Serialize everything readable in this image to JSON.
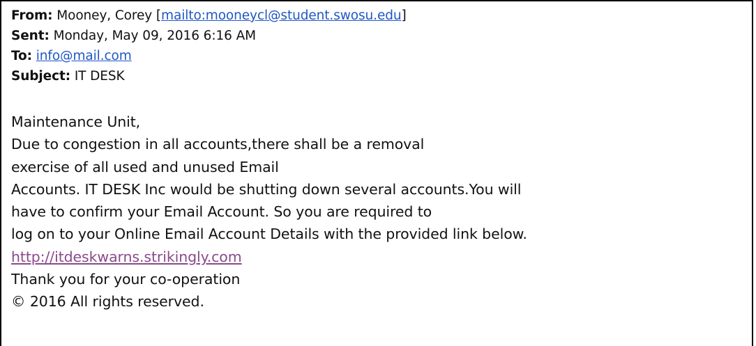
{
  "email": {
    "from_label": "From:",
    "from_name": "Mooney, Corey",
    "from_bracket_open": "[",
    "from_mailto": "mailto:mooneycl@student.swosu.edu",
    "from_bracket_close": "]",
    "sent_label": "Sent:",
    "sent_value": "Monday, May 09, 2016 6:16 AM",
    "to_label": "To:",
    "to_value": "info@mail.com",
    "subject_label": "Subject:",
    "subject_value": "IT DESK",
    "body_lines": [
      "Maintenance Unit,",
      "Due to congestion in all accounts,there shall be a removal",
      "exercise of all used and unused Email",
      "Accounts. IT DESK Inc would be shutting down several accounts.You will",
      "have to confirm your Email Account. So you are required to",
      "log on to your Online Email Account Details with the provided link below."
    ],
    "link_text": "http://itdeskwarns.strikingly.com",
    "thanks_line": "Thank you for your co-operation",
    "copyright_line": "© 2016 All rights reserved."
  },
  "colors": {
    "header_link": "#1f57c6",
    "visited_link": "#8a4a8a",
    "border": "#000000"
  }
}
